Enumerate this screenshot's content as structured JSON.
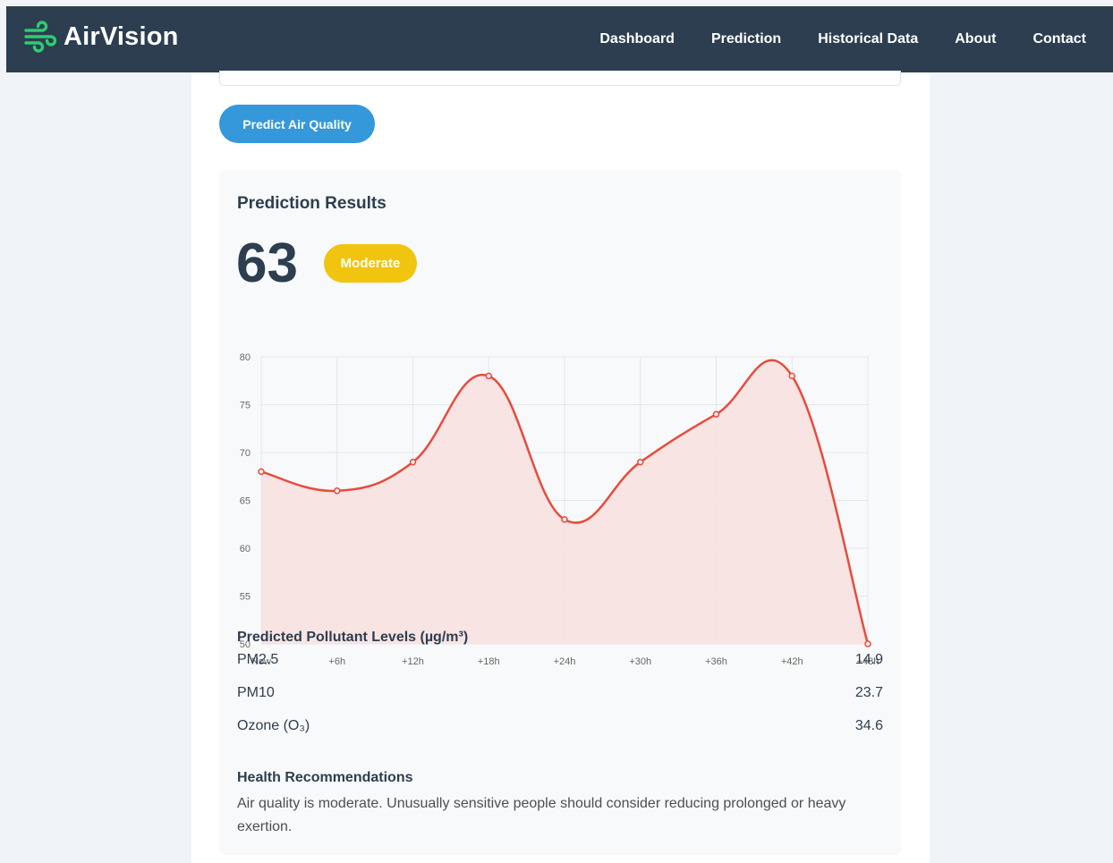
{
  "brand": {
    "name": "AirVision",
    "accent": "#2ecc71"
  },
  "nav": {
    "items": [
      "Dashboard",
      "Prediction",
      "Historical Data",
      "About",
      "Contact"
    ]
  },
  "form": {
    "predict_button": "Predict Air Quality"
  },
  "results": {
    "title": "Prediction Results",
    "aqi": "63",
    "category": "Moderate",
    "category_color": "#f1c40f"
  },
  "chart_data": {
    "type": "line",
    "x": [
      "Now",
      "+6h",
      "+12h",
      "+18h",
      "+24h",
      "+30h",
      "+36h",
      "+42h",
      "+48h"
    ],
    "series": [
      {
        "values": [
          68,
          66,
          69,
          78,
          63,
          69,
          74,
          78,
          50
        ]
      }
    ],
    "ylim": [
      50,
      80
    ],
    "yticks": [
      50,
      55,
      60,
      65,
      70,
      75,
      80
    ],
    "grid": true,
    "line_color": "#e74c3c",
    "fill_color": "#f8e1e1"
  },
  "pollutants": {
    "title": "Predicted Pollutant Levels (µg/m³)",
    "items": [
      {
        "name": "PM2.5",
        "value": "14.9"
      },
      {
        "name": "PM10",
        "value": "23.7"
      },
      {
        "name": "Ozone (O₃)",
        "value": "34.6"
      }
    ]
  },
  "health": {
    "title": "Health Recommendations",
    "text": "Air quality is moderate. Unusually sensitive people should consider reducing prolonged or heavy exertion."
  }
}
